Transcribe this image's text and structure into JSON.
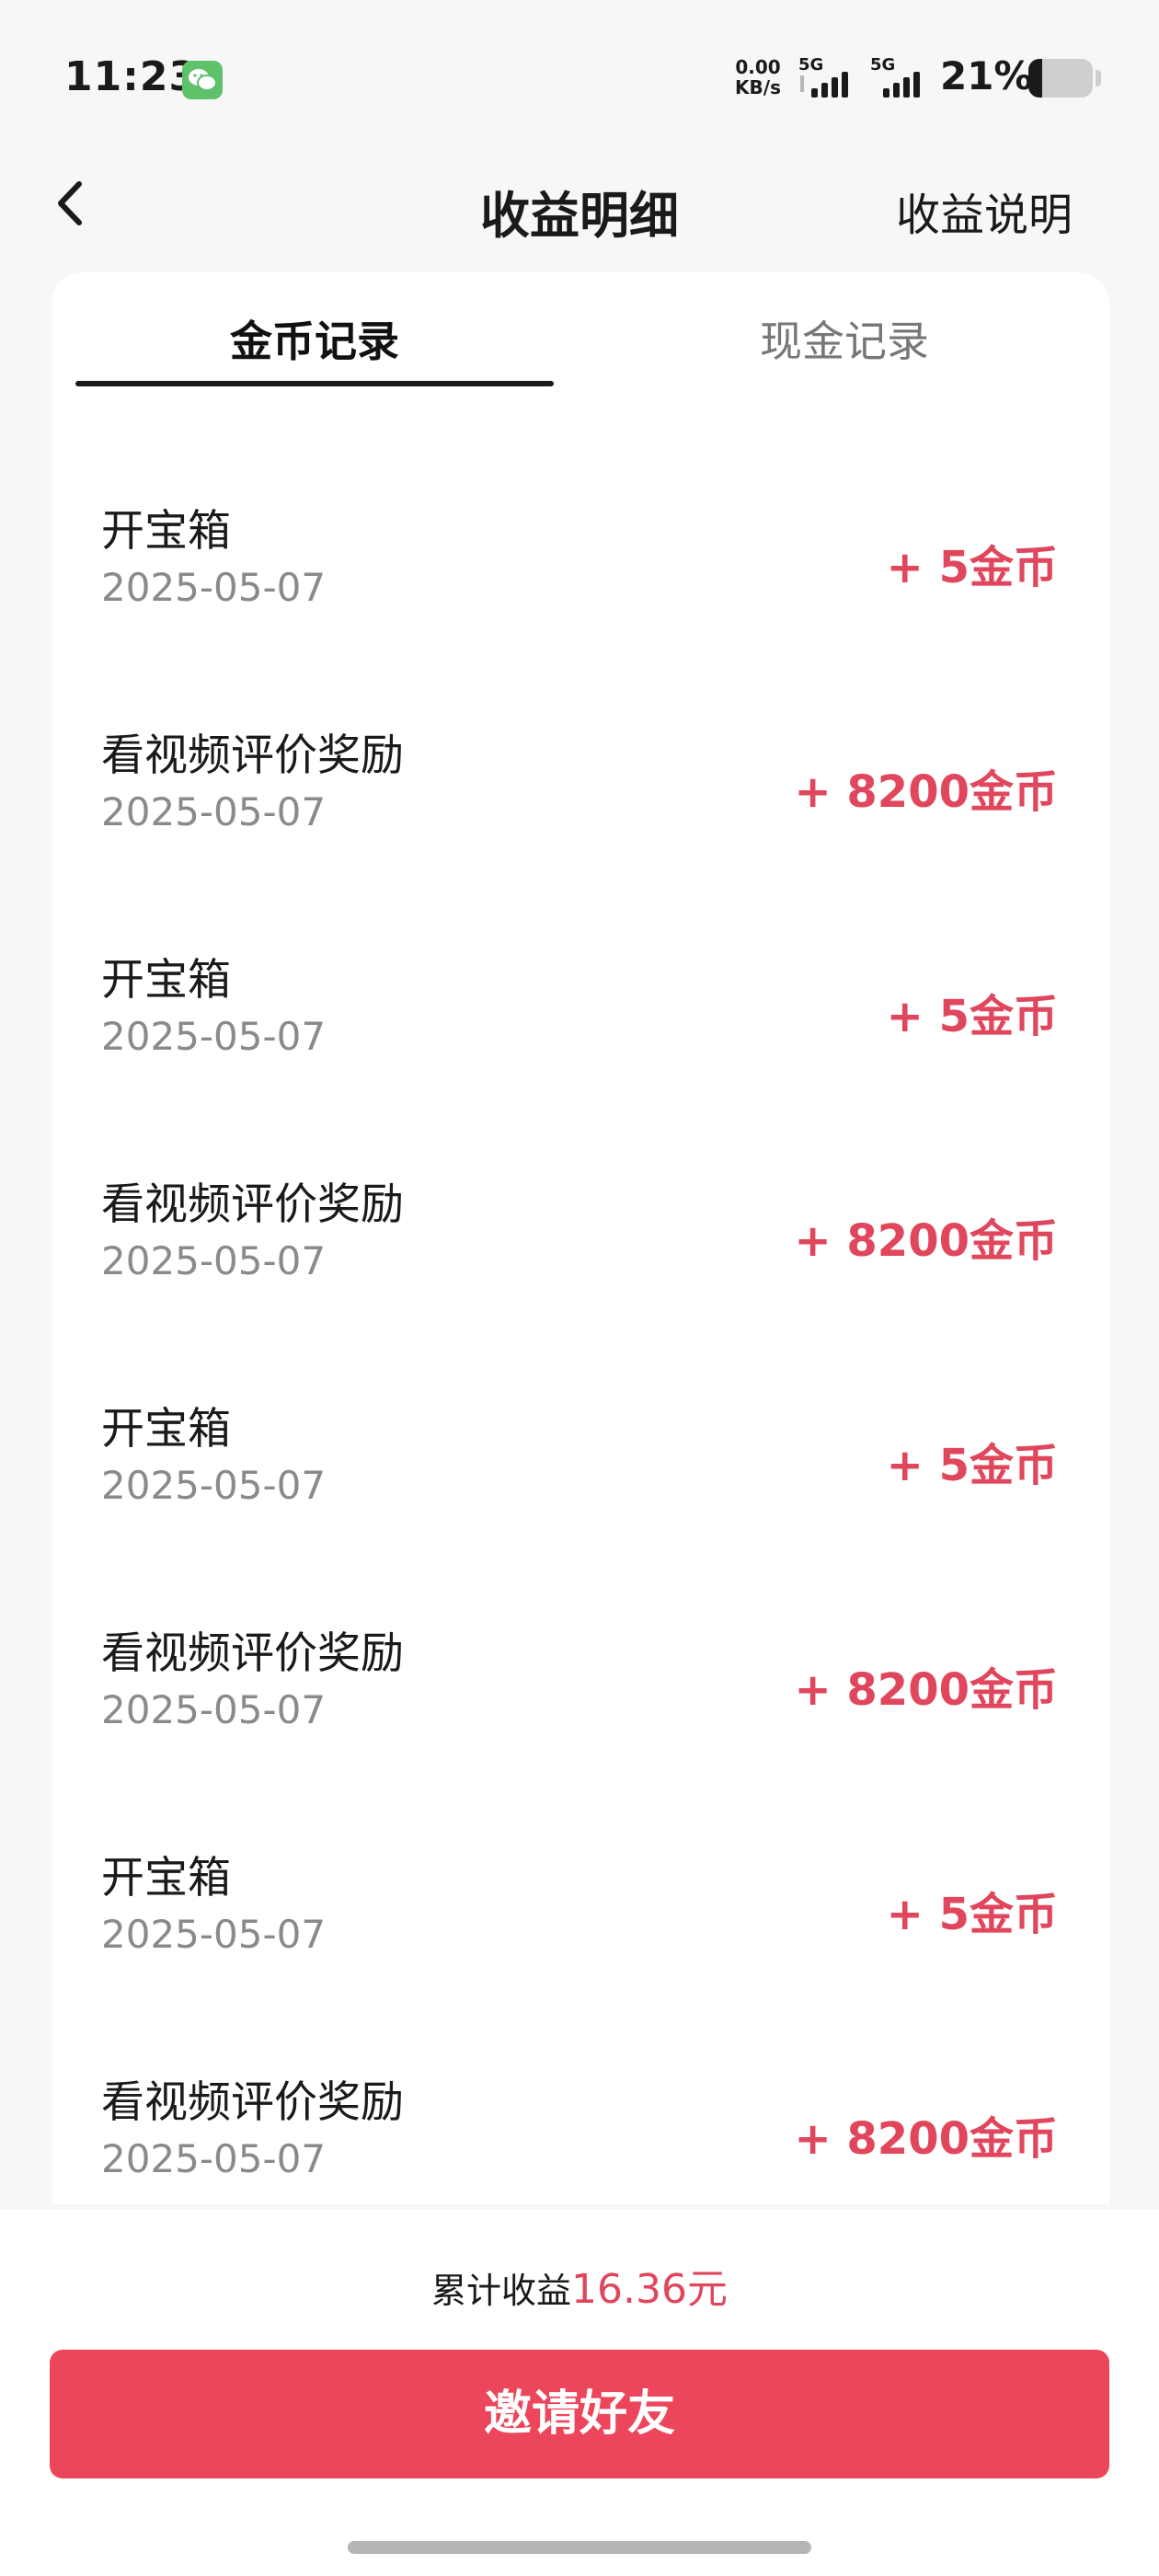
{
  "status_bar": {
    "time": "11:23",
    "app_notification_icon": "wechat-icon",
    "net_speed_value": "0.00",
    "net_speed_unit": "KB/s",
    "sim1_label": "5G",
    "sim2_label": "5G",
    "battery_percent_text": "21%",
    "battery_level": 0.21
  },
  "header": {
    "back_icon": "chevron-left-icon",
    "title": "收益明细",
    "help_link": "收益说明"
  },
  "tabs": [
    {
      "label": "金币记录",
      "active": true
    },
    {
      "label": "现金记录",
      "active": false
    }
  ],
  "records": [
    {
      "title": "开宝箱",
      "date": "2025-05-07",
      "amount": "+ 5金币"
    },
    {
      "title": "看视频评价奖励",
      "date": "2025-05-07",
      "amount": "+ 8200金币"
    },
    {
      "title": "开宝箱",
      "date": "2025-05-07",
      "amount": "+ 5金币"
    },
    {
      "title": "看视频评价奖励",
      "date": "2025-05-07",
      "amount": "+ 8200金币"
    },
    {
      "title": "开宝箱",
      "date": "2025-05-07",
      "amount": "+ 5金币"
    },
    {
      "title": "看视频评价奖励",
      "date": "2025-05-07",
      "amount": "+ 8200金币"
    },
    {
      "title": "开宝箱",
      "date": "2025-05-07",
      "amount": "+ 5金币"
    },
    {
      "title": "看视频评价奖励",
      "date": "2025-05-07",
      "amount": "+ 8200金币"
    }
  ],
  "footer": {
    "summary_label": "累计收益",
    "summary_value": "16.36元",
    "invite_button": "邀请好友"
  },
  "colors": {
    "accent": "#ec465c",
    "amount_text": "#e0465c",
    "background": "#f7f7f7",
    "card": "#ffffff"
  }
}
